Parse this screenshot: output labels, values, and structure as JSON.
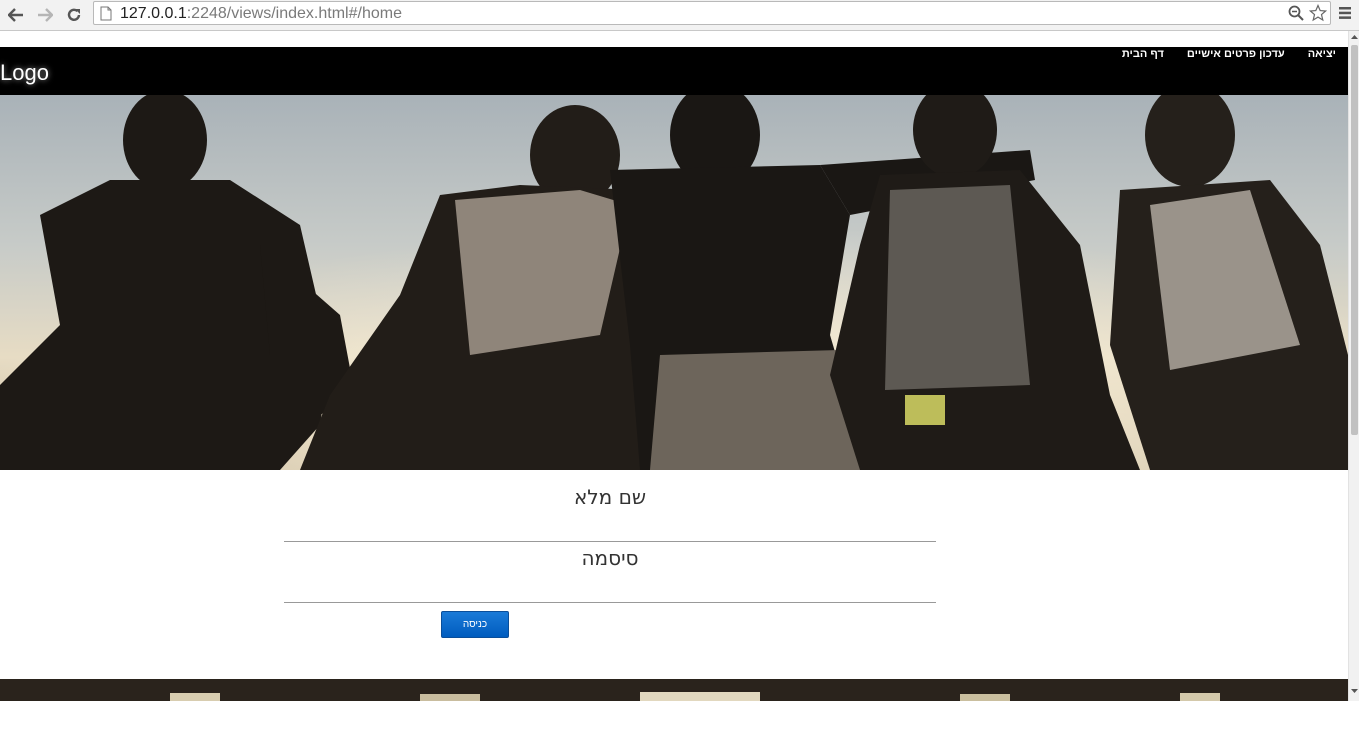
{
  "browser": {
    "url_host": "127.0.0.1",
    "url_rest": ":2248/views/index.html#/home"
  },
  "header": {
    "logo": "Logo",
    "nav": [
      "יציאה",
      "עדכון פרטים אישיים",
      "דף הבית"
    ]
  },
  "form": {
    "fullname_label": "שם מלא",
    "password_label": "סיסמה",
    "submit_label": "כניסה"
  },
  "icons": {
    "back": "arrow-left-icon",
    "forward": "arrow-right-icon",
    "reload": "reload-icon",
    "page": "page-icon",
    "zoom": "zoom-icon",
    "star": "star-icon",
    "menu": "menu-icon"
  }
}
